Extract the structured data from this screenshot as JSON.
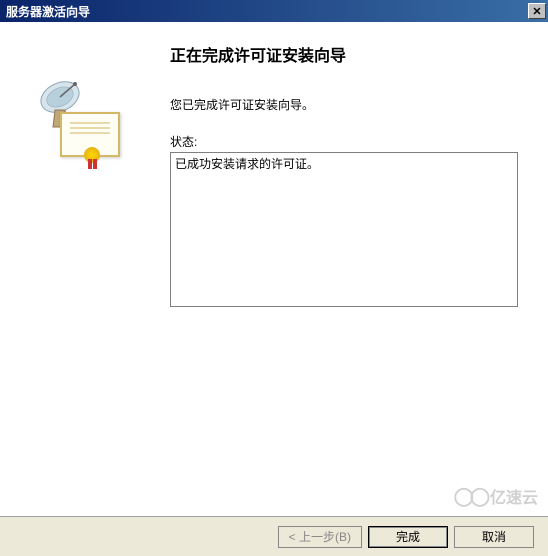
{
  "window": {
    "title": "服务器激活向导"
  },
  "wizard": {
    "heading": "正在完成许可证安装向导",
    "subtext": "您已完成许可证安装向导。",
    "status_label": "状态:",
    "status_message": "已成功安装请求的许可证。"
  },
  "buttons": {
    "back": "< 上一步(B)",
    "finish": "完成",
    "cancel": "取消"
  },
  "watermark": {
    "text": "亿速云"
  }
}
